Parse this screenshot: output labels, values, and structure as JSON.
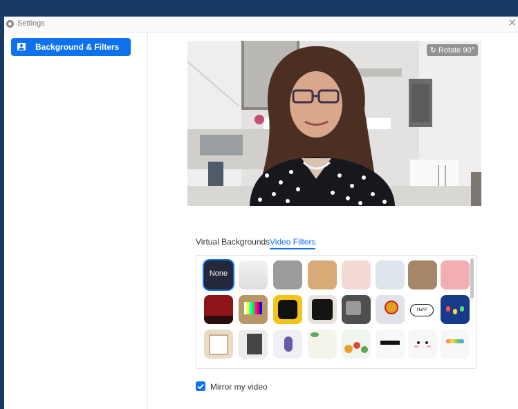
{
  "window": {
    "title": "Settings",
    "close_glyph": "✕"
  },
  "sidebar": {
    "items": [
      {
        "label": "Background & Filters",
        "icon": "portrait-icon",
        "active": true
      }
    ]
  },
  "preview": {
    "rotate_label": "Rotate 90°"
  },
  "tabs": [
    {
      "label": "Virtual Backgrounds",
      "active": false
    },
    {
      "label": "Video Filters",
      "active": true
    }
  ],
  "filters": {
    "selected": "None",
    "tiles": [
      "None",
      "studio-white",
      "studio-gray",
      "studio-beige",
      "studio-pink",
      "studio-blue",
      "studio-brown",
      "studio-rose",
      "theater-curtain",
      "tv-color-bars",
      "sunflower-frame",
      "bulb-mirror-frame",
      "retro-tv",
      "award-ribbon",
      "huh-speech-bubble",
      "string-lights",
      "picture-frame",
      "dark-portrait",
      "bird-illustration",
      "leaf-frame",
      "fruit-frame",
      "pixel-sunglasses",
      "cute-face",
      "rainbow-face"
    ],
    "speech_bubble_text": "Huh?"
  },
  "mirror": {
    "label": "Mirror my video",
    "checked": true
  },
  "colors": {
    "accent": "#0e72ed",
    "frame": "#173a63"
  }
}
